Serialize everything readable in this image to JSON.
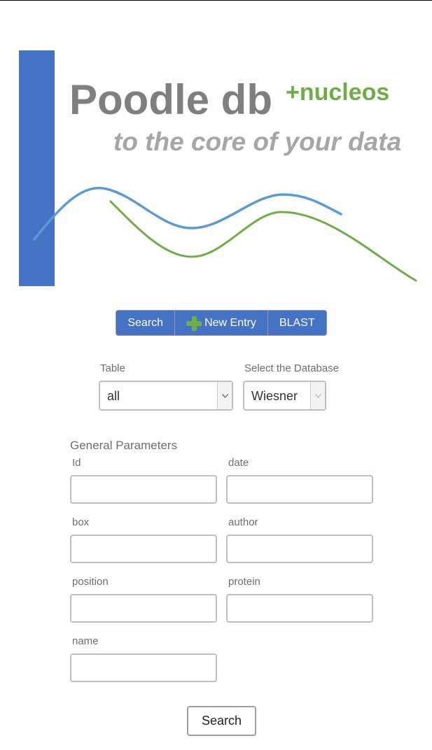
{
  "logo": {
    "title": "Poodle db",
    "suffix": "+nucleos",
    "tagline": "to the core of your data",
    "colors": {
      "bar": "#4472c4",
      "title": "#7f7f7f",
      "suffix": "#70ad47",
      "tagline": "#a6a6a6",
      "wave_blue": "#5b9bd5",
      "wave_green": "#70ad47"
    }
  },
  "nav": {
    "items": [
      {
        "label": "Search",
        "icon": null
      },
      {
        "label": "New Entry",
        "icon": "plus-icon"
      },
      {
        "label": "BLAST",
        "icon": null
      }
    ],
    "color": "#4472c4"
  },
  "filters": {
    "table": {
      "label": "Table",
      "value": "all"
    },
    "database": {
      "label": "Select the Database",
      "value": "Wiesner"
    }
  },
  "general_parameters": {
    "title": "General Parameters",
    "fields": [
      {
        "label": "Id",
        "value": ""
      },
      {
        "label": "date",
        "value": ""
      },
      {
        "label": "box",
        "value": ""
      },
      {
        "label": "author",
        "value": ""
      },
      {
        "label": "position",
        "value": ""
      },
      {
        "label": "protein",
        "value": ""
      },
      {
        "label": "name",
        "value": ""
      }
    ]
  },
  "submit": {
    "label": "Search"
  }
}
